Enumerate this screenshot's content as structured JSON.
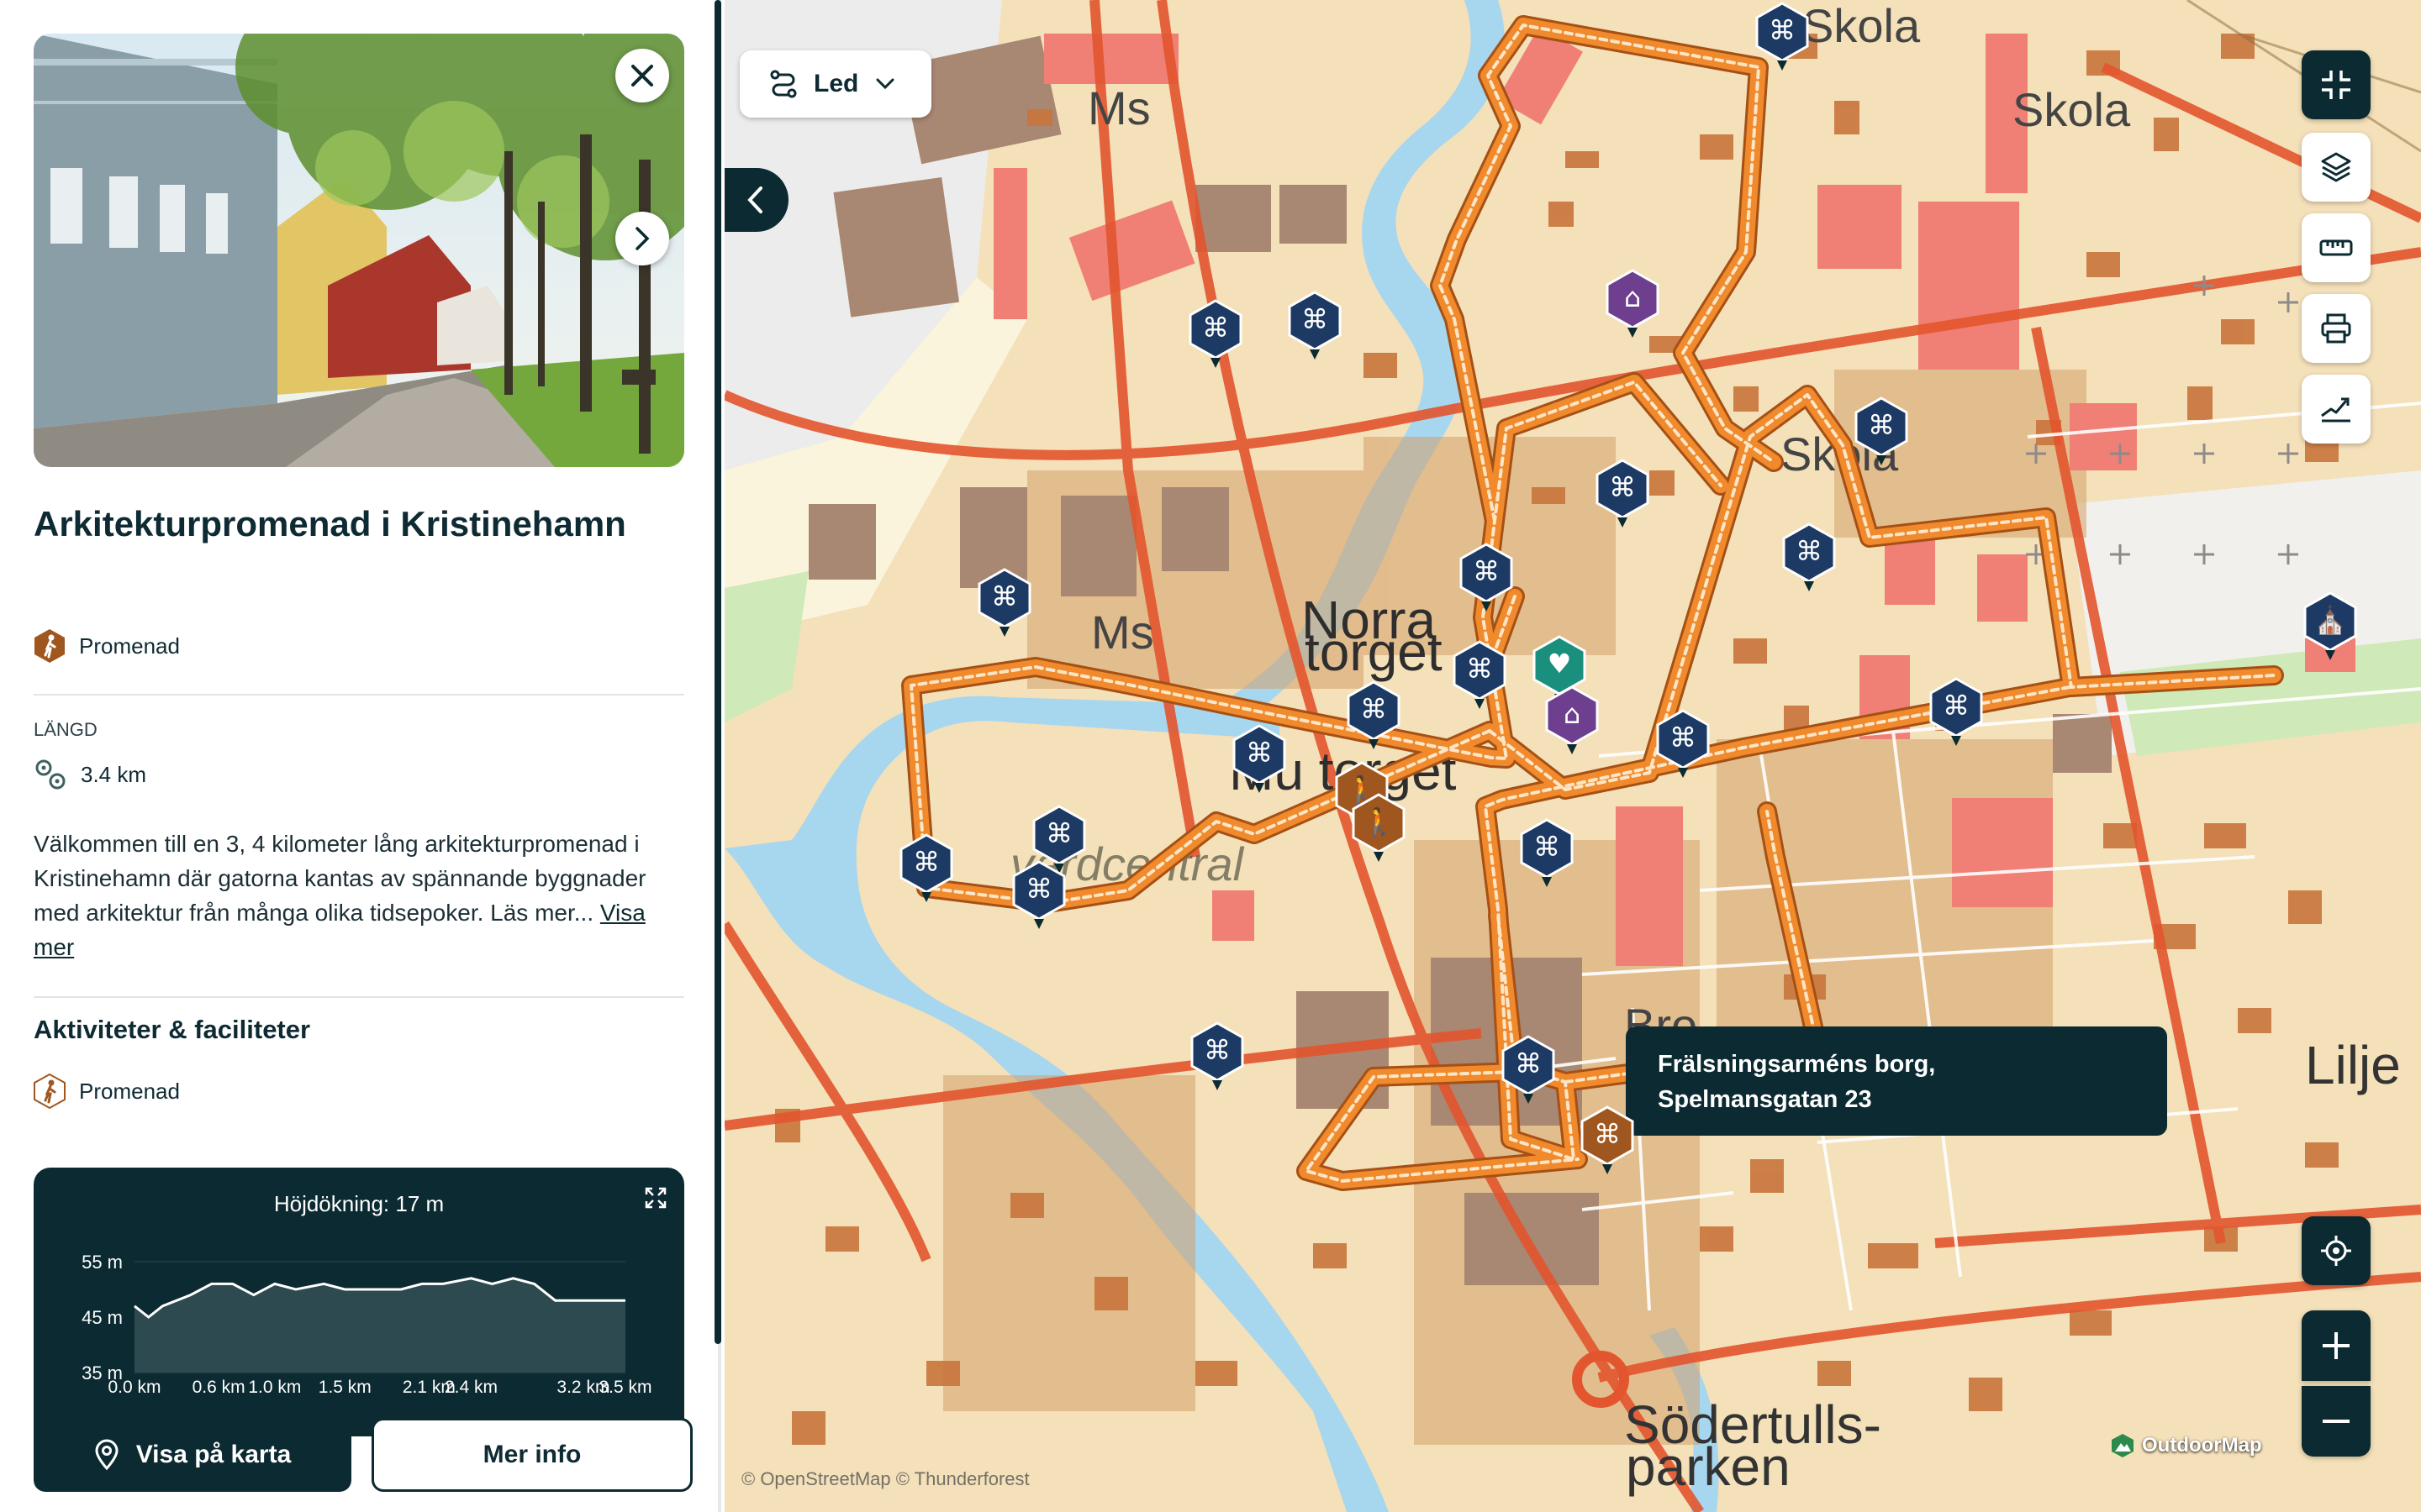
{
  "sidebar": {
    "title": "Arkitekturpromenad i Kristinehamn",
    "activity_type": "Promenad",
    "length_label": "LÄNGD",
    "length_value": "3.4 km",
    "description": "Välkommen till en 3, 4 kilometer lång arkitekturpromenad i Kristinehamn där gatorna kantas av spännande byggnader med arkitektur från många olika tidsepoker. Läs mer...",
    "show_more": "Visa mer",
    "facilities_heading": "Aktiviteter & faciliteter",
    "facility_item": "Promenad",
    "show_on_map": "Visa på karta",
    "more_info": "Mer info"
  },
  "elevation": {
    "title": "Höjdökning: 17 m",
    "y_ticks": [
      "55 m",
      "45 m",
      "35 m"
    ],
    "x_ticks": [
      "0.0 km",
      "0.6 km",
      "1.0 km",
      "1.5 km",
      "2.1 km",
      "2.4 km",
      "3.2 km",
      "3.5 km"
    ]
  },
  "chart_data": {
    "type": "area",
    "title": "Höjdökning: 17 m",
    "x": [
      0.0,
      0.1,
      0.2,
      0.4,
      0.55,
      0.7,
      0.85,
      1.0,
      1.15,
      1.35,
      1.5,
      1.7,
      1.9,
      2.05,
      2.2,
      2.4,
      2.55,
      2.7,
      2.85,
      3.0,
      3.2,
      3.35,
      3.5
    ],
    "y": [
      47,
      45,
      47,
      49,
      51,
      51,
      49,
      51,
      50,
      51,
      50,
      50,
      50,
      51,
      51,
      52,
      51,
      52,
      51,
      48,
      48,
      48,
      48
    ],
    "xlabel": "",
    "ylabel": "",
    "ylim": [
      35,
      55
    ],
    "xlim": [
      0,
      3.5
    ]
  },
  "map": {
    "route_selector": "Led",
    "tooltip_line1": "Frälsningsarméns borg,",
    "tooltip_line2": "Spelmansgatan 23",
    "attribution": "© OpenStreetMap © Thunderforest",
    "brand": "OutdoorMap",
    "labels": {
      "skola1": "Skola",
      "skola2": "Skola",
      "skola3": "Skola",
      "norra": "Norra",
      "torget": "torget",
      "ms1": "Ms",
      "ms2": "Ms",
      "mtorget": "Mu torget",
      "vardcentral": "vårdcentral",
      "sodertulls1": "Södertulls-",
      "sodertulls2": "parken",
      "lilje": "Lilje",
      "bro": "Bro"
    }
  },
  "colors": {
    "brand_dark": "#0c2a31",
    "route": "#e8731e",
    "poi": "#1c3a63",
    "hotel": "#6d3f8e",
    "health": "#1a8f7e",
    "activity": "#a0571f"
  }
}
